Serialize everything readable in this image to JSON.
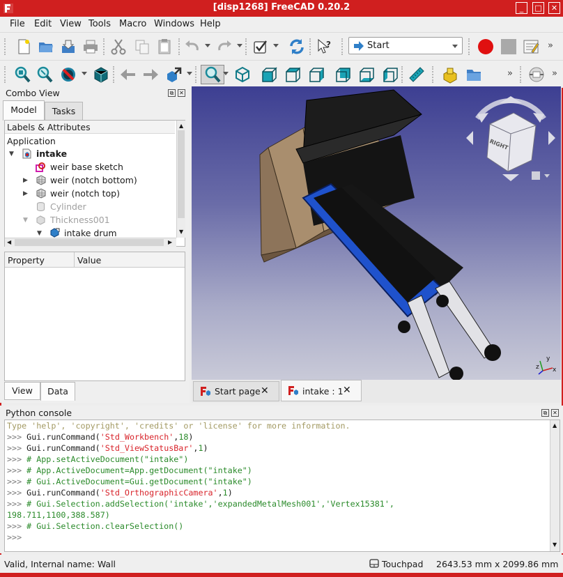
{
  "window": {
    "title": "[disp1268] FreeCAD 0.20.2"
  },
  "menu": [
    "File",
    "Edit",
    "View",
    "Tools",
    "Macro",
    "Windows",
    "Help"
  ],
  "toolbar": {
    "workbench": "Start",
    "more": "»"
  },
  "combo": {
    "title": "Combo View",
    "tabs": [
      "Model",
      "Tasks"
    ],
    "tree_header": "Labels & Attributes",
    "tree_root": "Application",
    "items": [
      {
        "label": "intake",
        "bold": true
      },
      {
        "label": "weir base sketch"
      },
      {
        "label": "weir (notch bottom)"
      },
      {
        "label": "weir (notch top)"
      },
      {
        "label": "Cylinder",
        "muted": true
      },
      {
        "label": "Thickness001",
        "muted": true
      },
      {
        "label": "intake drum"
      }
    ],
    "prop_headers": [
      "Property",
      "Value"
    ],
    "bottom_tabs": [
      "View",
      "Data"
    ]
  },
  "doc_tabs": [
    {
      "label": "Start page",
      "close": "✕"
    },
    {
      "label": "intake : 1",
      "close": "✕"
    }
  ],
  "console": {
    "title": "Python console",
    "lines": [
      [
        [
          "c-gray",
          "Type 'help', 'copyright', 'credits' or 'license' for more information."
        ]
      ],
      [
        [
          "c-prompt",
          ">>> "
        ],
        [
          "c-fn",
          "Gui.runCommand("
        ],
        [
          "c-str",
          "'Std_Workbench'"
        ],
        [
          "c-fn",
          ","
        ],
        [
          "c-num",
          "18"
        ],
        [
          "c-fn",
          ")"
        ]
      ],
      [
        [
          "c-prompt",
          ">>> "
        ],
        [
          "c-fn",
          "Gui.runCommand("
        ],
        [
          "c-str",
          "'Std_ViewStatusBar'"
        ],
        [
          "c-fn",
          ","
        ],
        [
          "c-num",
          "1"
        ],
        [
          "c-fn",
          ")"
        ]
      ],
      [
        [
          "c-prompt",
          ">>> "
        ],
        [
          "c-cmt",
          "# App.setActiveDocument(\"intake\")"
        ]
      ],
      [
        [
          "c-prompt",
          ">>> "
        ],
        [
          "c-cmt",
          "# App.ActiveDocument=App.getDocument(\"intake\")"
        ]
      ],
      [
        [
          "c-prompt",
          ">>> "
        ],
        [
          "c-cmt",
          "# Gui.ActiveDocument=Gui.getDocument(\"intake\")"
        ]
      ],
      [
        [
          "c-prompt",
          ">>> "
        ],
        [
          "c-fn",
          "Gui.runCommand("
        ],
        [
          "c-str",
          "'Std_OrthographicCamera'"
        ],
        [
          "c-fn",
          ","
        ],
        [
          "c-num",
          "1"
        ],
        [
          "c-fn",
          ")"
        ]
      ],
      [
        [
          "c-prompt",
          ">>> "
        ],
        [
          "c-cmt",
          "# Gui.Selection.addSelection('intake','expandedMetalMesh001','Vertex15381',"
        ]
      ],
      [
        [
          "c-cmt",
          "198.711,1100,388.587)"
        ]
      ],
      [
        [
          "c-prompt",
          ">>> "
        ],
        [
          "c-cmt",
          "# Gui.Selection.clearSelection()"
        ]
      ],
      [
        [
          "c-prompt",
          ">>> "
        ]
      ]
    ]
  },
  "status": {
    "message": "Valid, Internal name: Wall",
    "nav_style": "Touchpad",
    "dimensions": "2643.53 mm x 2099.86 mm"
  },
  "navcube": {
    "face_label": "RIGHT"
  },
  "axes": {
    "x": "x",
    "y": "y",
    "z": "z"
  }
}
